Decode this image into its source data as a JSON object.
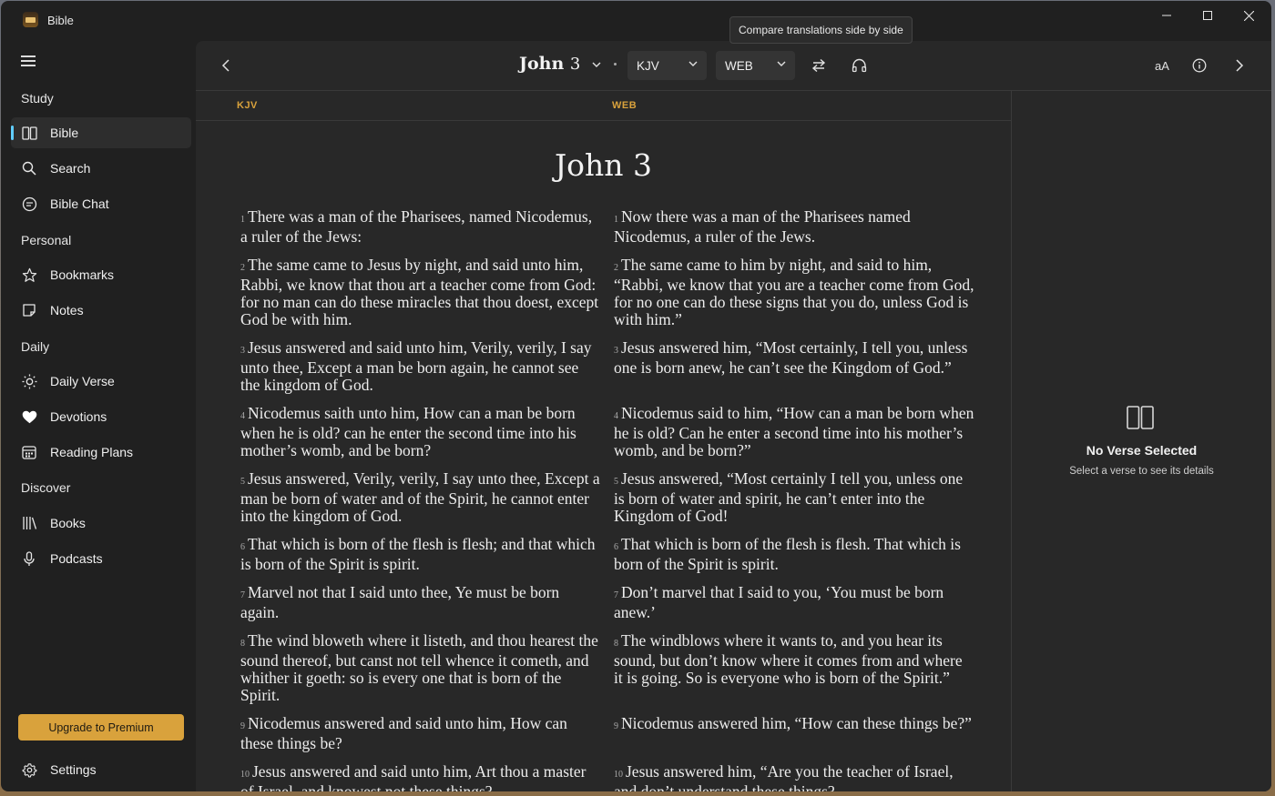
{
  "app": {
    "title": "Bible"
  },
  "sidebar": {
    "sections": [
      {
        "label": "Study"
      },
      {
        "label": "Personal"
      },
      {
        "label": "Daily"
      },
      {
        "label": "Discover"
      }
    ],
    "items": [
      {
        "label": "Bible",
        "icon": "book-open-icon"
      },
      {
        "label": "Search",
        "icon": "search-icon"
      },
      {
        "label": "Bible Chat",
        "icon": "chat-icon"
      },
      {
        "label": "Bookmarks",
        "icon": "star-icon"
      },
      {
        "label": "Notes",
        "icon": "note-icon"
      },
      {
        "label": "Daily Verse",
        "icon": "sun-icon"
      },
      {
        "label": "Devotions",
        "icon": "heart-icon"
      },
      {
        "label": "Reading Plans",
        "icon": "calendar-icon"
      },
      {
        "label": "Books",
        "icon": "library-icon"
      },
      {
        "label": "Podcasts",
        "icon": "microphone-icon"
      }
    ],
    "premium_label": "Upgrade to Premium",
    "settings_label": "Settings"
  },
  "toolbar": {
    "book": "John",
    "chapter": "3",
    "translation_primary": "KJV",
    "translation_secondary": "WEB",
    "tooltip": "Compare translations side by side",
    "font_size_label": "aA"
  },
  "reader": {
    "col_left_label": "KJV",
    "col_right_label": "WEB",
    "chapter_title": "John 3",
    "kjv": [
      {
        "n": "1",
        "text": "There was a man of the Pharisees, named Nicodemus, a ruler of the Jews:"
      },
      {
        "n": "2",
        "text": "The same came to Jesus by night, and said unto him, Rabbi, we know that thou art a teacher come from God: for no man can do these miracles that thou doest, except God be with him."
      },
      {
        "n": "3",
        "text": "Jesus answered and said unto him, Verily, verily, I say unto thee, Except a man be born again, he cannot see the kingdom of God."
      },
      {
        "n": "4",
        "text": "Nicodemus saith unto him, How can a man be born when he is old? can he enter the second time into his mother’s womb, and be born?"
      },
      {
        "n": "5",
        "text": "Jesus answered, Verily, verily, I say unto thee, Except a man be born of water and of the Spirit, he cannot enter into the kingdom of God."
      },
      {
        "n": "6",
        "text": "That which is born of the flesh is flesh; and that which is born of the Spirit is spirit."
      },
      {
        "n": "7",
        "text": "Marvel not that I said unto thee, Ye must be born again."
      },
      {
        "n": "8",
        "text": "The wind bloweth where it listeth, and thou hearest the sound thereof, but canst not tell whence it cometh, and whither it goeth: so is every one that is born of the Spirit."
      },
      {
        "n": "9",
        "text": "Nicodemus answered and said unto him, How can these things be?"
      },
      {
        "n": "10",
        "text": "Jesus answered and said unto him, Art thou a master of Israel, and knowest not these things?"
      }
    ],
    "web": [
      {
        "n": "1",
        "text": "Now there was a man of the Pharisees named Nicodemus, a ruler of the Jews."
      },
      {
        "n": "2",
        "text": "The same came to him by night, and said to him, “Rabbi, we know that you are a teacher come from God, for no one can do these signs that you do, unless God is with him.”"
      },
      {
        "n": "3",
        "text": "Jesus answered him, “Most certainly, I tell you, unless one is born anew, he can’t see the Kingdom of God.”"
      },
      {
        "n": "4",
        "text": "Nicodemus said to him, “How can a man be born when he is old? Can he enter a second time into his mother’s womb, and be born?”"
      },
      {
        "n": "5",
        "text": "Jesus answered, “Most certainly I tell you, unless one is born of water and spirit, he can’t enter into the Kingdom of God!"
      },
      {
        "n": "6",
        "text": "That which is born of the flesh is flesh. That which is born of the Spirit is spirit."
      },
      {
        "n": "7",
        "text": "Don’t marvel that I said to you, ‘You must be born anew.’"
      },
      {
        "n": "8",
        "text": "The windblows where it wants to, and you hear its sound, but don’t know where it comes from and where it is going. So is everyone who is born of the Spirit.”"
      },
      {
        "n": "9",
        "text": "Nicodemus answered him, “How can these things be?”"
      },
      {
        "n": "10",
        "text": "Jesus answered him, “Are you the teacher of Israel, and don’t understand these things?"
      }
    ]
  },
  "details": {
    "empty_title": "No Verse Selected",
    "empty_subtitle": "Select a verse to see its details"
  }
}
